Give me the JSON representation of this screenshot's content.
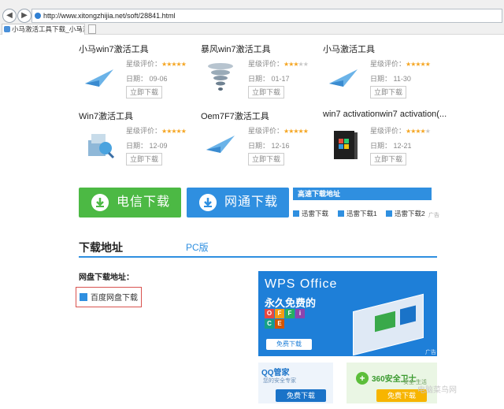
{
  "browser": {
    "url": "http://www.xitongzhijia.net/soft/28841.html",
    "tab_title": "小马激活工具下载_小马激...",
    "close_glyph": "×"
  },
  "apps": [
    {
      "title": "小马win7激活工具",
      "rating_label": "星级评价：",
      "stars": 5,
      "date_label": "日期：",
      "date": "09-06",
      "button": "立即下载",
      "icon": "paper-plane-icon"
    },
    {
      "title": "暴风win7激活工具",
      "rating_label": "星级评价：",
      "stars": 3,
      "date_label": "日期：",
      "date": "01-17",
      "button": "立即下载",
      "icon": "tornado-icon"
    },
    {
      "title": "小马激活工具",
      "rating_label": "星级评价：",
      "stars": 5,
      "date_label": "日期：",
      "date": "11-30",
      "button": "立即下载",
      "icon": "paper-plane-icon"
    },
    {
      "title": "Win7激活工具",
      "rating_label": "星级评价：",
      "stars": 5,
      "date_label": "日期：",
      "date": "12-09",
      "button": "立即下载",
      "icon": "installer-icon"
    },
    {
      "title": "Oem7F7激活工具",
      "rating_label": "星级评价：",
      "stars": 5,
      "date_label": "日期：",
      "date": "12-16",
      "button": "立即下载",
      "icon": "paper-plane-icon"
    },
    {
      "title": "win7 activationwin7 activation(...",
      "rating_label": "星级评价：",
      "stars": 4,
      "date_label": "日期：",
      "date": "12-21",
      "button": "立即下载",
      "icon": "windows-box-icon"
    }
  ],
  "download": {
    "telecom": "电信下载",
    "netcom": "网通下载",
    "fast_title": "高速下载地址",
    "xunlei": [
      "迅雷下载",
      "迅雷下载1",
      "迅雷下载2"
    ],
    "ad_tag": "广告"
  },
  "section": {
    "title": "下载地址",
    "tab": "PC版",
    "pan_label": "网盘下载地址：",
    "pan_link": "百度网盘下载"
  },
  "ads": {
    "wps_logo": "WPS Office",
    "wps_sub": "永久免费的",
    "wps_tiles": [
      "O",
      "F",
      "F",
      "i",
      "C",
      "E"
    ],
    "wps_btn": "免费下载",
    "ad_tag": "广告",
    "qq_logo": "QQ管家",
    "qq_slogan": "您的安全专家",
    "qq_btn": "免费下载",
    "s360_logo": "360安全卫士",
    "s360_slogan": "安全 生活",
    "s360_btn": "免费下载",
    "watermark": "电脑菜鸟网"
  },
  "colors": {
    "green": "#4cb944",
    "blue": "#2f8fe0",
    "star": "#f5a623",
    "red_box": "#d9534f"
  }
}
